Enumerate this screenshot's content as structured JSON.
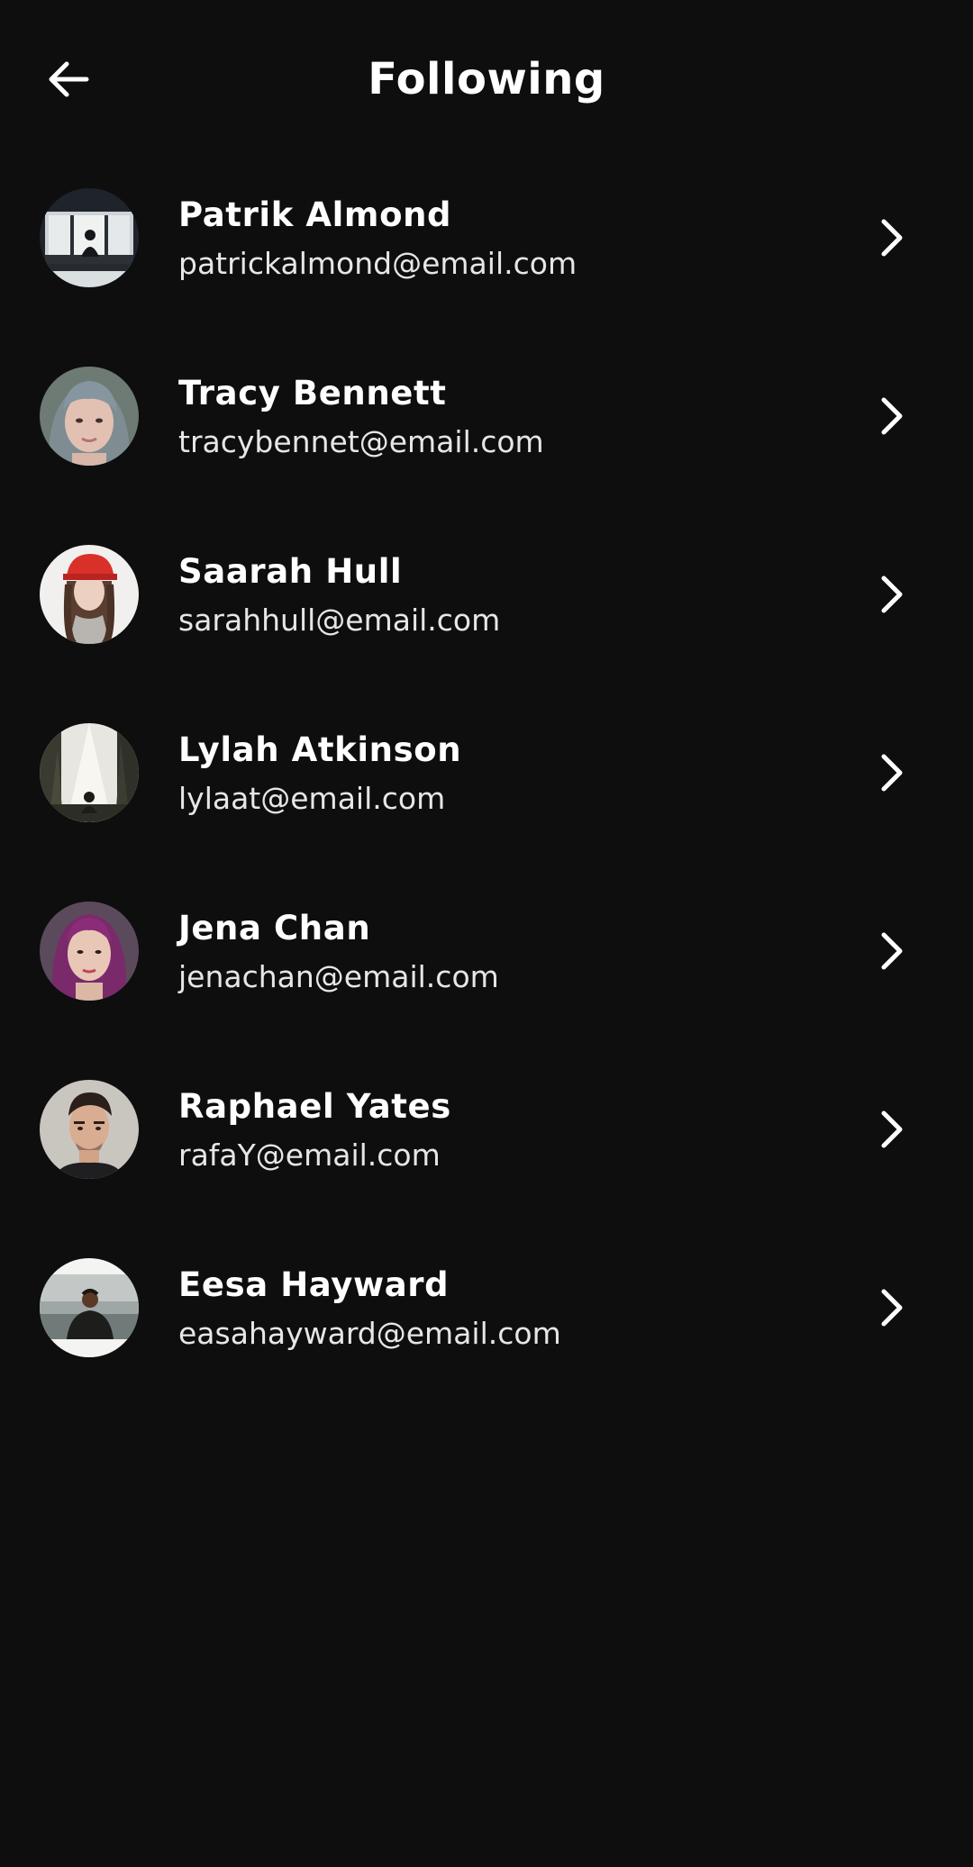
{
  "header": {
    "title": "Following",
    "back_icon": "arrow-left-icon"
  },
  "following": [
    {
      "name": "Patrik Almond",
      "email": "patrickalmond@email.com"
    },
    {
      "name": "Tracy Bennett",
      "email": "tracybennet@email.com"
    },
    {
      "name": "Saarah Hull",
      "email": "sarahhull@email.com"
    },
    {
      "name": "Lylah Atkinson",
      "email": "lylaat@email.com"
    },
    {
      "name": "Jena Chan",
      "email": "jenachan@email.com"
    },
    {
      "name": "Raphael Yates",
      "email": "rafaY@email.com"
    },
    {
      "name": "Eesa Hayward",
      "email": "easahayward@email.com"
    }
  ],
  "icons": {
    "row_action": "chevron-right-icon",
    "avatar": "avatar-photo"
  },
  "colors": {
    "background": "#0e0e0e",
    "text_primary": "#ffffff",
    "text_secondary": "#e6e6e6"
  }
}
